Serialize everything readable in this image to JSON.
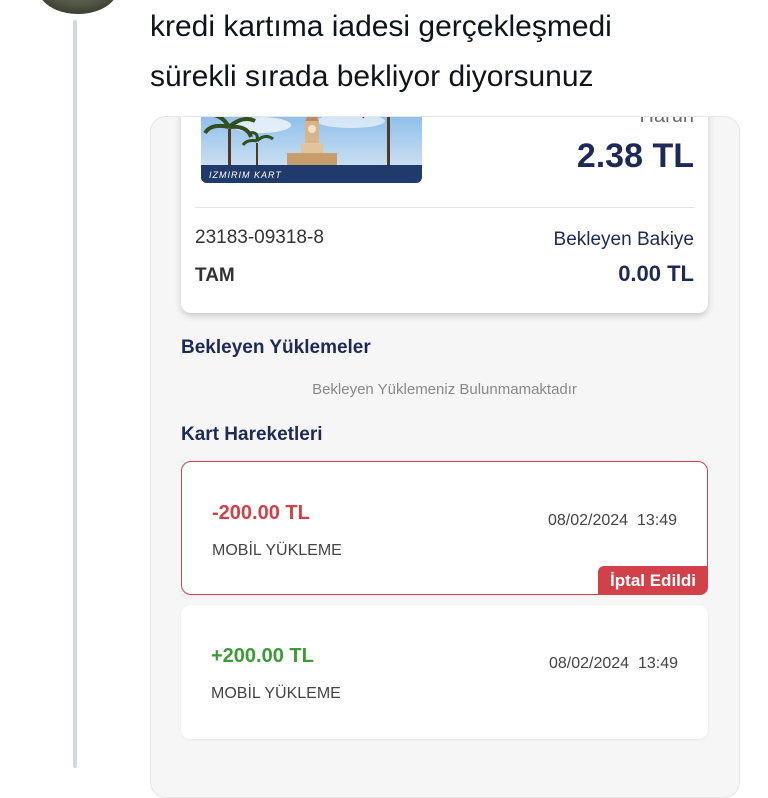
{
  "tweet": {
    "line1": "kredi kartıma iadesi gerçekleşmedi",
    "line2": "sürekli sırada bekliyor diyorsunuz"
  },
  "card": {
    "image_label": "IZMIRIM KART",
    "holder_name": "Harun",
    "balance": "2.38 TL",
    "number": "23183-09318-8",
    "type": "TAM",
    "pending_label": "Bekleyen Bakiye",
    "pending_amount": "0.00 TL"
  },
  "pending_section": {
    "title": "Bekleyen Yüklemeler",
    "empty_message": "Bekleyen Yüklemeniz Bulunmamaktadır"
  },
  "transactions_section": {
    "title": "Kart Hareketleri",
    "items": [
      {
        "amount": "-200.00 TL",
        "description": "MOBİL YÜKLEME",
        "datetime": "08/02/2024  13:49",
        "badge": "İptal Edildi"
      },
      {
        "amount": "+200.00 TL",
        "description": "MOBİL YÜKLEME",
        "datetime": "08/02/2024  13:49"
      }
    ]
  },
  "colors": {
    "navy": "#1e2a55",
    "cancel_red": "#d2404a",
    "positive_green": "#3b9b37"
  }
}
